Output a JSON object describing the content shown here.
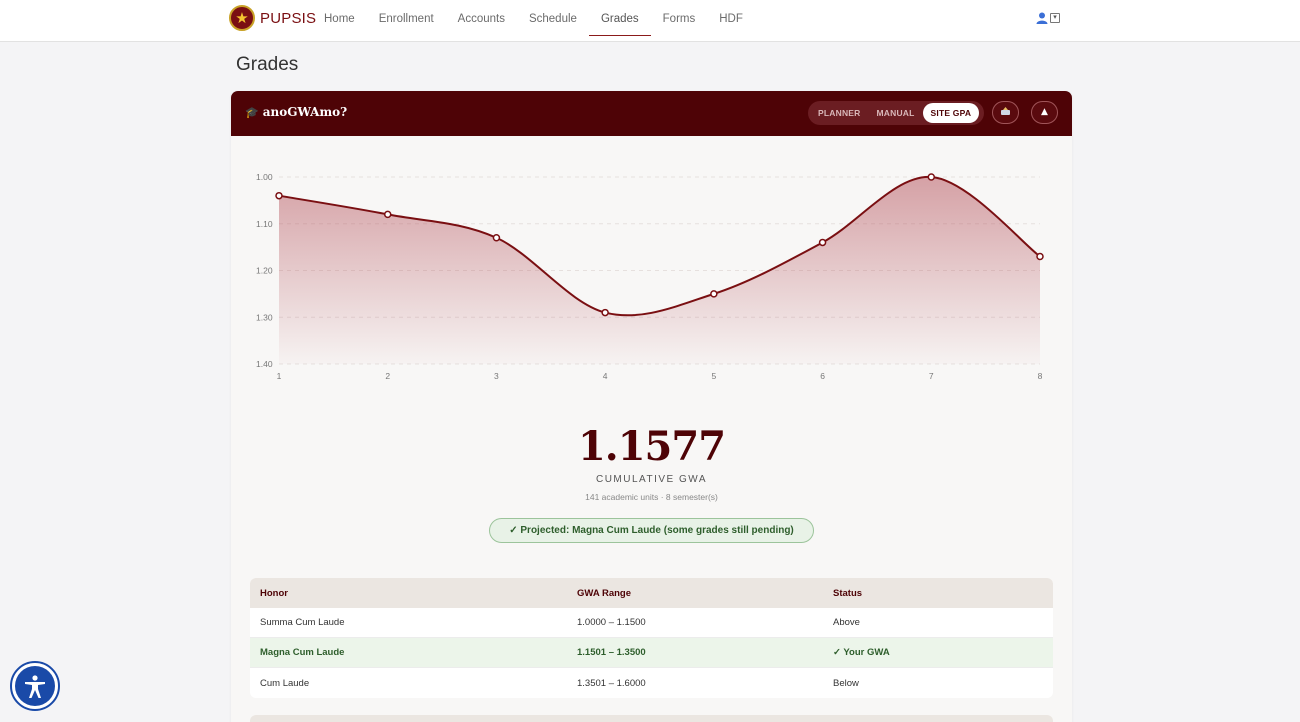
{
  "navbar": {
    "brand": "PUPSIS",
    "items": [
      {
        "label": "Home"
      },
      {
        "label": "Enrollment"
      },
      {
        "label": "Accounts"
      },
      {
        "label": "Schedule"
      },
      {
        "label": "Grades",
        "active": true
      },
      {
        "label": "Forms"
      },
      {
        "label": "HDF"
      }
    ],
    "user_icon": "user-icon",
    "user_menu_icon": "chevron-down-icon"
  },
  "page": {
    "title": "Grades"
  },
  "card": {
    "icon": "🎓",
    "title": "anoGWAmo?",
    "modes": [
      {
        "label": "PLANNER"
      },
      {
        "label": "MANUAL"
      },
      {
        "label": "SITE GPA",
        "active": true
      }
    ],
    "export_icon": "export-icon",
    "collapse_icon": "collapse-up-icon"
  },
  "chart_data": {
    "type": "area",
    "x": [
      "1",
      "2",
      "3",
      "4",
      "5",
      "6",
      "7",
      "8"
    ],
    "values": [
      1.04,
      1.08,
      1.13,
      1.29,
      1.25,
      1.14,
      1.0,
      1.17
    ],
    "y_ticks": [
      "1.00",
      "1.10",
      "1.20",
      "1.30",
      "1.40"
    ],
    "ylim": [
      1.0,
      1.4
    ],
    "y_reversed": true,
    "grid": true,
    "line_color": "#7a0f12",
    "fill_color": "#b85a63"
  },
  "summary": {
    "gwa": "1.1577",
    "label": "CUMULATIVE GWA",
    "sub": "141 academic units · 8 semester(s)",
    "projection": "✓  Projected: Magna Cum Laude (some grades still pending)"
  },
  "honors_table": {
    "headers": [
      "Honor",
      "GWA Range",
      "Status"
    ],
    "rows": [
      {
        "honor": "Summa Cum Laude",
        "range": "1.0000 – 1.1500",
        "status": "Above"
      },
      {
        "honor": "Magna Cum Laude",
        "range": "1.1501 – 1.3500",
        "status": "✓ Your GWA"
      },
      {
        "honor": "Cum Laude",
        "range": "1.3501 – 1.6000",
        "status": "Below"
      }
    ]
  },
  "accessibility": {
    "icon": "accessibility-icon"
  },
  "colors": {
    "brand": "#4e0306",
    "accent": "#7a0f12",
    "success": "#2e5e2c"
  }
}
